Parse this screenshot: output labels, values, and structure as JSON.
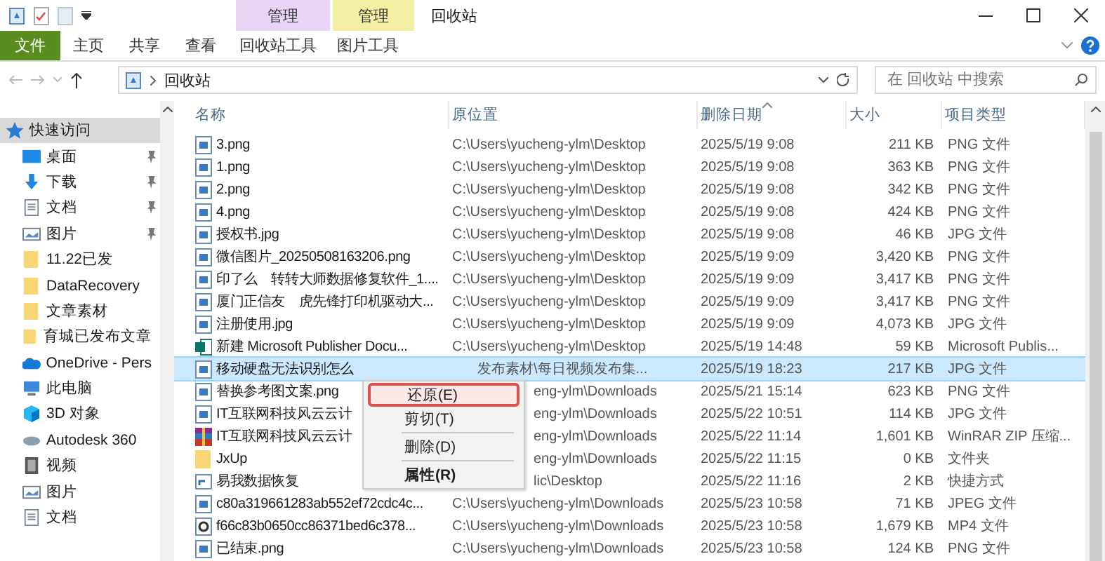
{
  "window": {
    "title": "回收站"
  },
  "context_groups": [
    {
      "label": "管理",
      "color": "#e8d5f5"
    },
    {
      "label": "管理",
      "color": "#f2efa2"
    }
  ],
  "ribbon_tabs": [
    {
      "label": "文件",
      "kind": "file"
    },
    {
      "label": "主页",
      "kind": "tab"
    },
    {
      "label": "共享",
      "kind": "tab"
    },
    {
      "label": "查看",
      "kind": "tab"
    },
    {
      "label": "回收站工具",
      "kind": "tab"
    },
    {
      "label": "图片工具",
      "kind": "tab"
    }
  ],
  "address": {
    "path": "回收站"
  },
  "search": {
    "placeholder": "在 回收站 中搜索"
  },
  "sidebar": {
    "items": [
      {
        "label": "快速访问",
        "kind": "star",
        "pinned": false,
        "selected": true
      },
      {
        "label": "桌面",
        "kind": "desktop",
        "pinned": true,
        "selected": false
      },
      {
        "label": "下载",
        "kind": "download",
        "pinned": true,
        "selected": false
      },
      {
        "label": "文档",
        "kind": "document",
        "pinned": true,
        "selected": false
      },
      {
        "label": "图片",
        "kind": "picture",
        "pinned": true,
        "selected": false
      },
      {
        "label": "11.22已发",
        "kind": "folder",
        "pinned": false,
        "selected": false
      },
      {
        "label": "DataRecovery",
        "kind": "folder",
        "pinned": false,
        "selected": false
      },
      {
        "label": "文章素材",
        "kind": "folder",
        "pinned": false,
        "selected": false
      },
      {
        "label": "育城已发布文章",
        "kind": "folder",
        "pinned": false,
        "selected": false
      },
      {
        "label": "OneDrive - Pers",
        "kind": "cloud",
        "pinned": false,
        "selected": false
      },
      {
        "label": "此电脑",
        "kind": "computer",
        "pinned": false,
        "selected": false
      },
      {
        "label": "3D 对象",
        "kind": "cube",
        "pinned": false,
        "selected": false
      },
      {
        "label": "Autodesk 360",
        "kind": "autodesk",
        "pinned": false,
        "selected": false
      },
      {
        "label": "视频",
        "kind": "video",
        "pinned": false,
        "selected": false
      },
      {
        "label": "图片",
        "kind": "picture",
        "pinned": false,
        "selected": false
      },
      {
        "label": "文档",
        "kind": "document",
        "pinned": false,
        "selected": false
      }
    ]
  },
  "table": {
    "columns": [
      {
        "label": "名称",
        "sorted": false
      },
      {
        "label": "原位置",
        "sorted": false
      },
      {
        "label": "删除日期",
        "sorted": true
      },
      {
        "label": "大小",
        "sorted": false
      },
      {
        "label": "项目类型",
        "sorted": false
      }
    ],
    "rows": [
      {
        "kind": "image",
        "name": "3.png",
        "location": "C:\\Users\\yucheng-ylm\\Desktop",
        "deleted": "2025/5/19 9:08",
        "size": "211 KB",
        "type": "PNG 文件",
        "selected": false
      },
      {
        "kind": "image",
        "name": "1.png",
        "location": "C:\\Users\\yucheng-ylm\\Desktop",
        "deleted": "2025/5/19 9:08",
        "size": "363 KB",
        "type": "PNG 文件",
        "selected": false
      },
      {
        "kind": "image",
        "name": "2.png",
        "location": "C:\\Users\\yucheng-ylm\\Desktop",
        "deleted": "2025/5/19 9:08",
        "size": "342 KB",
        "type": "PNG 文件",
        "selected": false
      },
      {
        "kind": "image",
        "name": "4.png",
        "location": "C:\\Users\\yucheng-ylm\\Desktop",
        "deleted": "2025/5/19 9:08",
        "size": "424 KB",
        "type": "PNG 文件",
        "selected": false
      },
      {
        "kind": "image",
        "name": "授权书.jpg",
        "location": "C:\\Users\\yucheng-ylm\\Desktop",
        "deleted": "2025/5/19 9:08",
        "size": "46 KB",
        "type": "JPG 文件",
        "selected": false
      },
      {
        "kind": "image",
        "name": "微信图片_20250508163206.png",
        "location": "C:\\Users\\yucheng-ylm\\Desktop",
        "deleted": "2025/5/19 9:09",
        "size": "3,420 KB",
        "type": "PNG 文件",
        "selected": false
      },
      {
        "kind": "image",
        "name": "印了么　转转大师数据修复软件_1....",
        "location": "C:\\Users\\yucheng-ylm\\Desktop",
        "deleted": "2025/5/19 9:09",
        "size": "3,417 KB",
        "type": "PNG 文件",
        "selected": false
      },
      {
        "kind": "image",
        "name": "厦门正信友　虎先锋打印机驱动大...",
        "location": "C:\\Users\\yucheng-ylm\\Desktop",
        "deleted": "2025/5/19 9:09",
        "size": "3,417 KB",
        "type": "PNG 文件",
        "selected": false
      },
      {
        "kind": "image",
        "name": "注册使用.jpg",
        "location": "C:\\Users\\yucheng-ylm\\Desktop",
        "deleted": "2025/5/19 9:09",
        "size": "4,073 KB",
        "type": "JPG 文件",
        "selected": false
      },
      {
        "kind": "publisher",
        "name": "新建 Microsoft Publisher Docu...",
        "location": "C:\\Users\\yucheng-ylm\\Desktop",
        "deleted": "2025/5/19 14:48",
        "size": "59 KB",
        "type": "Microsoft Publis...",
        "selected": false
      },
      {
        "kind": "image",
        "name": "移动硬盘无法识别怎么",
        "location": "发布素材\\每日视频发布集...",
        "deleted": "2025/5/19 18:23",
        "size": "217 KB",
        "type": "JPG 文件",
        "selected": true
      },
      {
        "kind": "image",
        "name": "替换参考图文案.png",
        "location": "eng-ylm\\Downloads",
        "deleted": "2025/5/21 15:14",
        "size": "623 KB",
        "type": "PNG 文件",
        "selected": false
      },
      {
        "kind": "image",
        "name": "IT互联网科技风云云计",
        "location": "eng-ylm\\Downloads",
        "deleted": "2025/5/22 10:51",
        "size": "114 KB",
        "type": "JPG 文件",
        "selected": false
      },
      {
        "kind": "zip",
        "name": "IT互联网科技风云云计",
        "location": "eng-ylm\\Downloads",
        "deleted": "2025/5/22 11:14",
        "size": "1,601 KB",
        "type": "WinRAR ZIP 压缩...",
        "selected": false
      },
      {
        "kind": "folder",
        "name": "JxUp",
        "location": "eng-ylm\\Downloads",
        "deleted": "2025/5/22 11:15",
        "size": "0 KB",
        "type": "文件夹",
        "selected": false
      },
      {
        "kind": "shortcut",
        "name": "易我数据恢复",
        "location": "lic\\Desktop",
        "deleted": "2025/5/22 11:16",
        "size": "2 KB",
        "type": "快捷方式",
        "selected": false
      },
      {
        "kind": "image",
        "name": "c80a319661283ab552ef72cdc4c...",
        "location": "C:\\Users\\yucheng-ylm\\Downloads",
        "deleted": "2025/5/23 10:58",
        "size": "71 KB",
        "type": "JPEG 文件",
        "selected": false
      },
      {
        "kind": "media",
        "name": "f66c83b0650cc86371bed6c378...",
        "location": "C:\\Users\\yucheng-ylm\\Downloads",
        "deleted": "2025/5/23 10:58",
        "size": "1,679 KB",
        "type": "MP4 文件",
        "selected": false
      },
      {
        "kind": "image",
        "name": "已结束.png",
        "location": "C:\\Users\\yucheng-ylm\\Downloads",
        "deleted": "2025/5/23 10:58",
        "size": "124 KB",
        "type": "PNG 文件",
        "selected": false
      }
    ]
  },
  "context_menu": {
    "items": [
      {
        "label": "还原(E)",
        "selected": true,
        "bold": false,
        "separator_before": false
      },
      {
        "label": "剪切(T)",
        "selected": false,
        "bold": false,
        "separator_before": false
      },
      {
        "label": "删除(D)",
        "selected": false,
        "bold": false,
        "separator_before": true
      },
      {
        "label": "属性(R)",
        "selected": false,
        "bold": true,
        "separator_before": true
      }
    ]
  }
}
